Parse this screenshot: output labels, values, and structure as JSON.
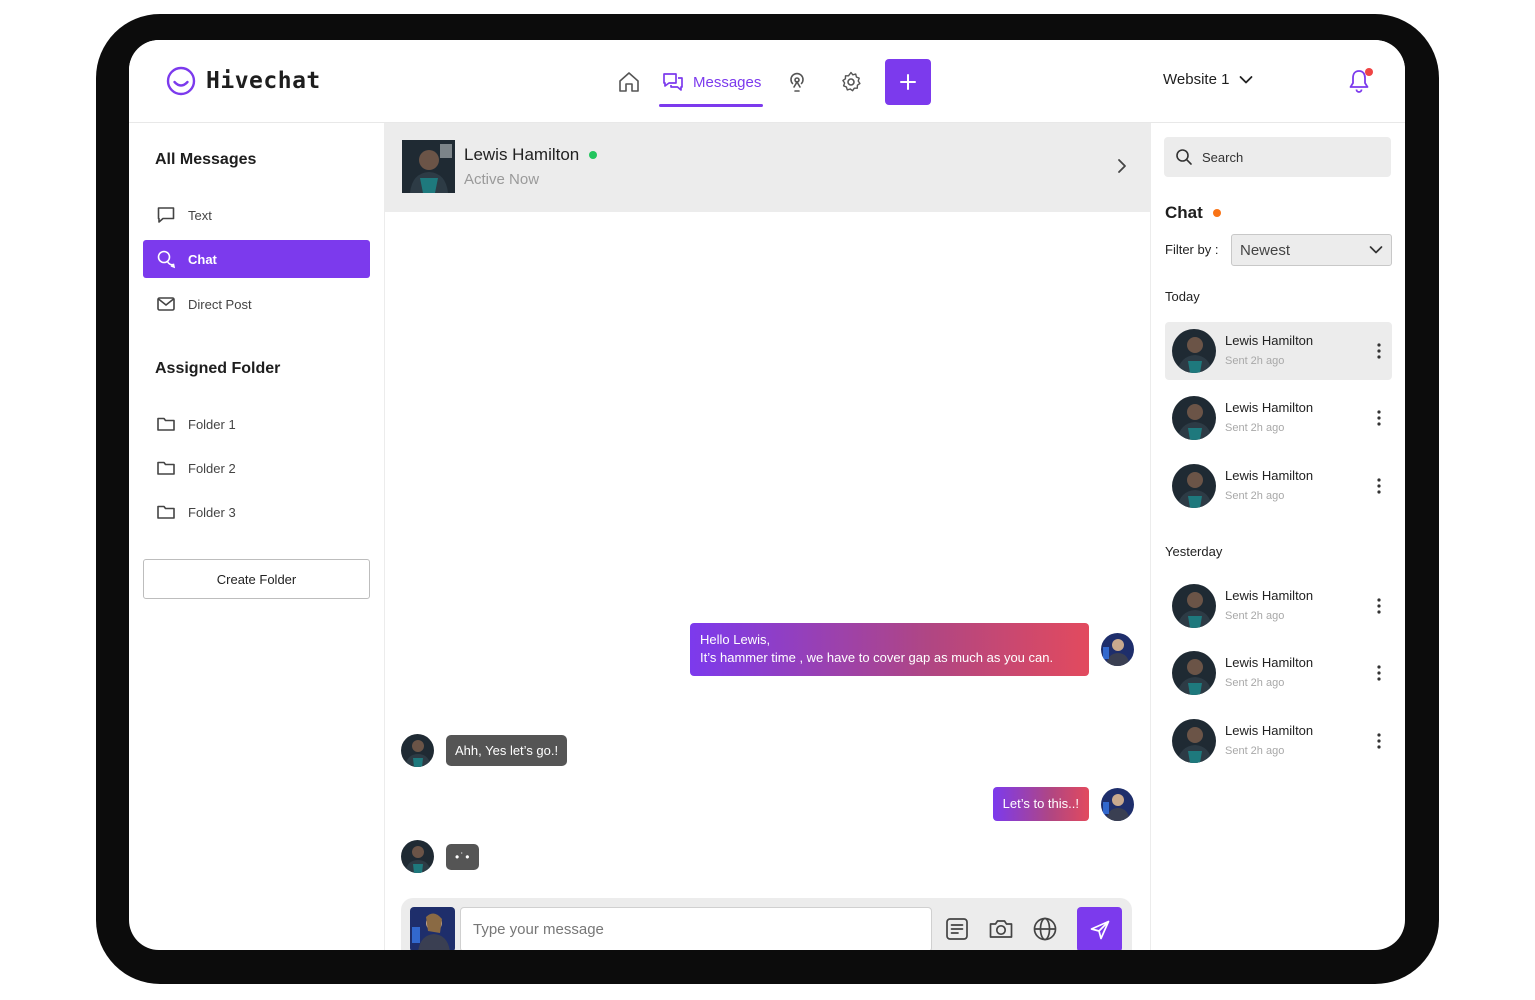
{
  "app": {
    "name": "Hivechat"
  },
  "nav": {
    "messages_label": "Messages",
    "website_label": "Website 1"
  },
  "sidebar": {
    "all_messages_title": "All Messages",
    "items": [
      {
        "label": "Text",
        "icon": "text-bubble-icon"
      },
      {
        "label": "Chat",
        "icon": "chat-bubbles-icon",
        "active": true
      },
      {
        "label": "Direct Post",
        "icon": "mail-icon"
      }
    ],
    "assigned_folder_title": "Assigned Folder",
    "folders": [
      {
        "label": "Folder 1"
      },
      {
        "label": "Folder 2"
      },
      {
        "label": "Folder 3"
      }
    ],
    "create_folder_label": "Create Folder"
  },
  "chat": {
    "contact_name": "Lewis Hamilton",
    "contact_status": "Active Now",
    "messages": [
      {
        "from": "me",
        "lines": [
          "Hello Lewis,",
          "It’s hammer time , we have to cover gap as much as you can."
        ]
      },
      {
        "from": "them",
        "text": "Ahh, Yes let’s go.!"
      },
      {
        "from": "me",
        "text": "Let’s to this..!"
      },
      {
        "from": "them",
        "text": "•˙•"
      }
    ],
    "composer_placeholder": "Type your message"
  },
  "right_panel": {
    "search_placeholder": "Search",
    "chat_title": "Chat",
    "filter_label": "Filter by :",
    "filter_value": "Newest",
    "groups": [
      {
        "label": "Today",
        "items": [
          {
            "name": "Lewis Hamilton",
            "time": "Sent 2h ago",
            "selected": true
          },
          {
            "name": "Lewis Hamilton",
            "time": "Sent 2h ago"
          },
          {
            "name": "Lewis Hamilton",
            "time": "Sent 2h ago"
          }
        ]
      },
      {
        "label": "Yesterday",
        "items": [
          {
            "name": "Lewis Hamilton",
            "time": "Sent 2h ago"
          },
          {
            "name": "Lewis Hamilton",
            "time": "Sent 2h ago"
          },
          {
            "name": "Lewis Hamilton",
            "time": "Sent 2h ago"
          }
        ]
      }
    ]
  },
  "colors": {
    "accent": "#7c3aed",
    "online": "#22c55e",
    "alert": "#ef4444",
    "orange": "#f97316",
    "gradient_end": "#e24a5e"
  }
}
